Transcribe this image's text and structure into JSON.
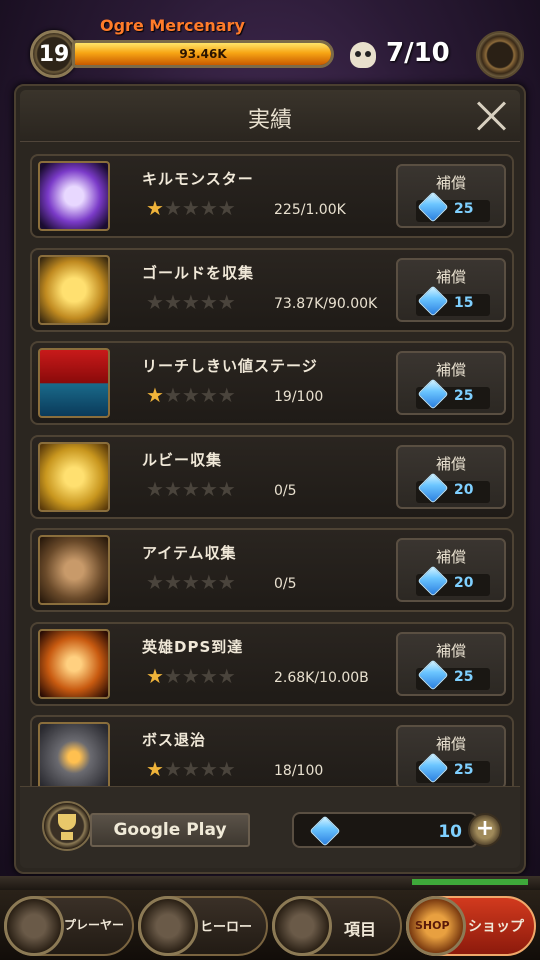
{
  "hud": {
    "level": "19",
    "enemy_name": "Ogre Mercenary",
    "hp_text": "93.46K",
    "hp_fraction": 1.0,
    "kill_count": "7/10"
  },
  "panel": {
    "title": "実績",
    "rows": [
      {
        "name": "キルモンスター",
        "stars": 1,
        "progress": "225/1.00K",
        "reward_label": "補償",
        "reward": "25",
        "icon": "ghost-skull-icon"
      },
      {
        "name": "ゴールドを収集",
        "stars": 0,
        "progress": "73.87K/90.00K",
        "reward_label": "補償",
        "reward": "15",
        "icon": "gold-chest-icon"
      },
      {
        "name": "リーチしきい値ステージ",
        "stars": 1,
        "progress": "19/100",
        "reward_label": "補償",
        "reward": "25",
        "icon": "down-arrow-icon"
      },
      {
        "name": "ルビー収集",
        "stars": 0,
        "progress": "0/5",
        "reward_label": "補償",
        "reward": "20",
        "icon": "treasure-chest-icon"
      },
      {
        "name": "アイテム収集",
        "stars": 0,
        "progress": "0/5",
        "reward_label": "補償",
        "reward": "20",
        "icon": "armor-items-icon"
      },
      {
        "name": "英雄DPS到達",
        "stars": 1,
        "progress": "2.68K/10.00B",
        "reward_label": "補償",
        "reward": "25",
        "icon": "hero-attack-icon"
      },
      {
        "name": "ボス退治",
        "stars": 1,
        "progress": "18/100",
        "reward_label": "補償",
        "reward": "25",
        "icon": "boss-eye-icon"
      }
    ]
  },
  "footer": {
    "google_play_label": "Google Play",
    "gem_total": "10",
    "plus_label": "+"
  },
  "nav": {
    "player": "プレーヤー",
    "hero": "ヒーロー",
    "items": "項目",
    "shop": "ショップ",
    "shop_sign": "SHOP"
  }
}
